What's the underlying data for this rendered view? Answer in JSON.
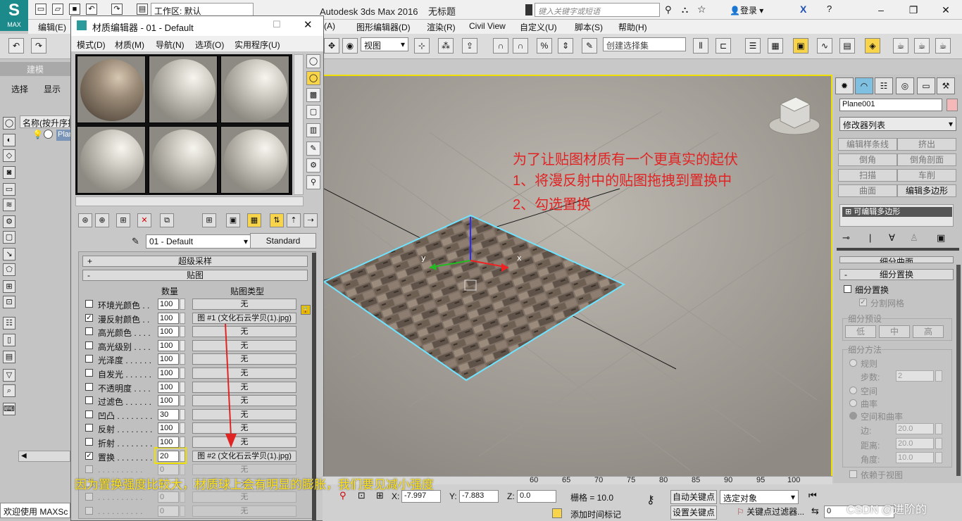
{
  "app": {
    "logo_text": "MAX",
    "workspace": "工作区: 默认",
    "title": "Autodesk 3ds Max 2016",
    "doc_title": "无标题",
    "search_placeholder": "键入关键字或短语",
    "login": "登录"
  },
  "main_menu": [
    "编辑(E)",
    "(A)",
    "图形编辑器(D)",
    "渲染(R)",
    "Civil View",
    "自定义(U)",
    "脚本(S)",
    "帮助(H)"
  ],
  "toolbar": {
    "view_dropdown": "视图",
    "selection_set": "创建选择集"
  },
  "left_panel": {
    "tab": "建模",
    "select": "选择",
    "display": "显示",
    "scene_header": "名称(按升序排",
    "scene_item": "Plan",
    "welcome": "欢迎使用 MAXSc"
  },
  "material_editor": {
    "title": "材质编辑器 - 01 - Default",
    "menu": [
      "模式(D)",
      "材质(M)",
      "导航(N)",
      "选项(O)",
      "实用程序(U)"
    ],
    "material_name": "01 - Default",
    "material_type": "Standard",
    "rollouts": {
      "supersampling": "超级采样",
      "maps": "贴图"
    },
    "column_amount": "数量",
    "column_maptype": "贴图类型",
    "maps": [
      {
        "label": "环境光颜色 . .",
        "checked": false,
        "amount": "100",
        "map": "无"
      },
      {
        "label": "漫反射颜色 . .",
        "checked": true,
        "amount": "100",
        "map": "图 #1 (文化石云学贝(1).jpg)"
      },
      {
        "label": "高光颜色 . . . .",
        "checked": false,
        "amount": "100",
        "map": "无"
      },
      {
        "label": "高光级别 . . . .",
        "checked": false,
        "amount": "100",
        "map": "无"
      },
      {
        "label": "光泽度 . . . . . .",
        "checked": false,
        "amount": "100",
        "map": "无"
      },
      {
        "label": "自发光 . . . . . .",
        "checked": false,
        "amount": "100",
        "map": "无"
      },
      {
        "label": "不透明度 . . . .",
        "checked": false,
        "amount": "100",
        "map": "无"
      },
      {
        "label": "过滤色 . . . . . .",
        "checked": false,
        "amount": "100",
        "map": "无"
      },
      {
        "label": "凹凸 . . . . . . . .",
        "checked": false,
        "amount": "30",
        "map": "无"
      },
      {
        "label": "反射 . . . . . . . .",
        "checked": false,
        "amount": "100",
        "map": "无"
      },
      {
        "label": "折射 . . . . . . . .",
        "checked": false,
        "amount": "100",
        "map": "无"
      },
      {
        "label": "置换 . . . . . . . .",
        "checked": true,
        "amount": "20",
        "map": "图 #2 (文化石云学贝(1).jpg)"
      },
      {
        "label": ". . . . . . . . . .",
        "checked": false,
        "amount": "0",
        "map": "无"
      },
      {
        "label": ". . . . . . . . . .",
        "checked": false,
        "amount": "0",
        "map": "无"
      },
      {
        "label": ". . . . . . . . . .",
        "checked": false,
        "amount": "0",
        "map": "无"
      },
      {
        "label": ". . . . . . . . . .",
        "checked": false,
        "amount": "0",
        "map": "无"
      }
    ]
  },
  "viewport": {
    "annotation_lines": [
      "为了让贴图材质有一个更真实的起伏",
      "1、将漫反射中的贴图拖拽到置换中",
      "2、勾选置换"
    ],
    "axis_y": "y",
    "axis_x": "x"
  },
  "right_panel": {
    "object_name": "Plane001",
    "modifier_list": "修改器列表",
    "modifier_buttons": [
      "编辑样条线",
      "挤出",
      "倒角",
      "倒角剖面",
      "扫描",
      "车削",
      "曲面",
      "编辑多边形"
    ],
    "stack_item": "可编辑多边形",
    "rollout_subdiv_surface": "细分曲面",
    "rollout_subdiv_disp": "细分置换",
    "subdiv_disp_checkbox": "细分置换",
    "split_mesh": "分割网格",
    "preset_group": "细分预设",
    "preset_buttons": [
      "低",
      "中",
      "高"
    ],
    "method_group": "细分方法",
    "regular": "规则",
    "steps_label": "步数:",
    "steps_value": "2",
    "spatial": "空间",
    "curvature": "曲率",
    "spatial_curvature": "空间和曲率",
    "edge_label": "边:",
    "edge_value": "20.0",
    "distance_label": "距离:",
    "distance_value": "20.0",
    "angle_label": "角度:",
    "angle_value": "10.0",
    "view_dependent": "依赖于视图"
  },
  "status": {
    "ruler_numbers": [
      "60",
      "65",
      "70",
      "75",
      "80",
      "85",
      "90",
      "95",
      "100"
    ],
    "x_label": "X:",
    "x_value": "-7.997",
    "y_label": "Y:",
    "y_value": "-7.883",
    "z_label": "Z:",
    "z_value": "0.0",
    "grid": "栅格 = 10.0",
    "auto_key": "自动关键点",
    "set_key": "设置关键点",
    "key_mode": "选定对象",
    "key_filters": "关键点过滤器...",
    "add_time_tag": "添加时间标记",
    "frame": "0"
  },
  "bottom_annotation": "因为置换强度比较大，材质球上会有明显的膨胀，我们要见减小强度",
  "watermark": "CSDN @进阶的",
  "colors": {
    "highlight": "#f0e000",
    "annotation_red": "#e02424",
    "annotation_yellow": "#ffe31a",
    "selection_cyan": "#6fe3ff"
  }
}
